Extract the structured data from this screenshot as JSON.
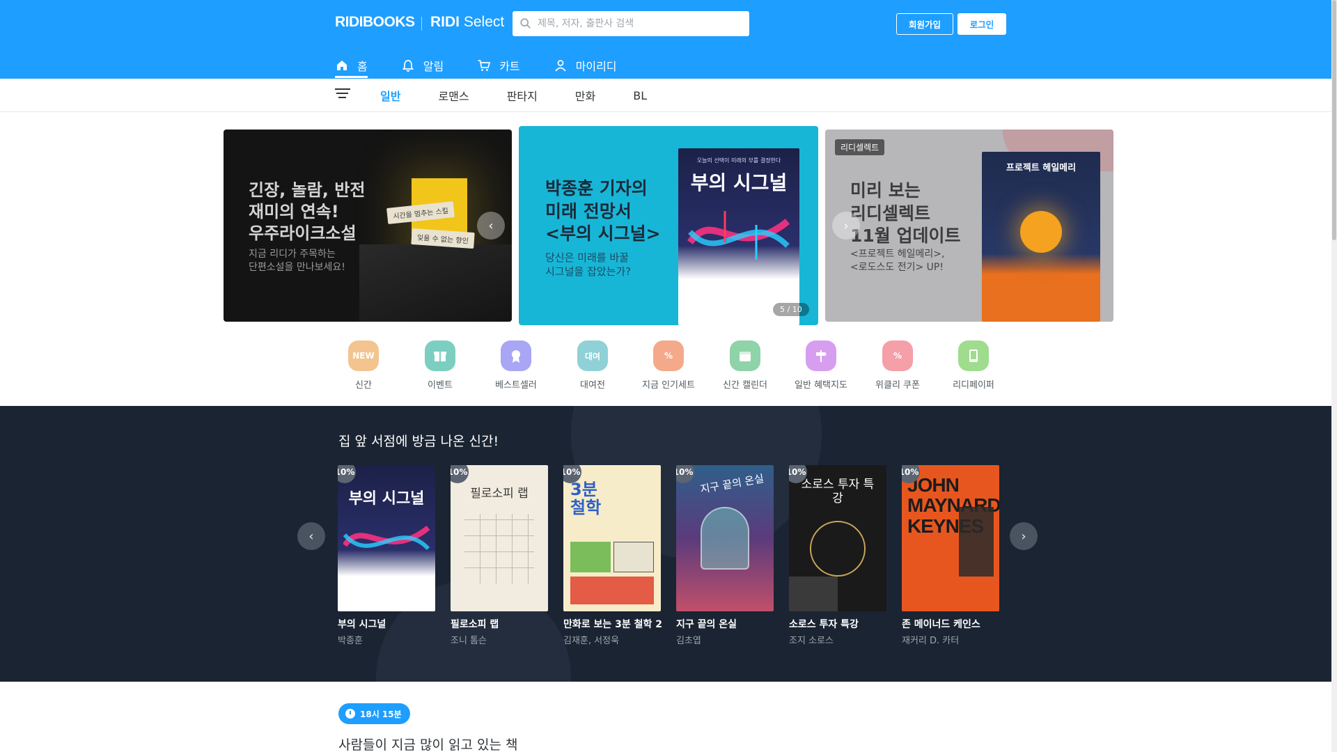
{
  "header": {
    "logo_main": "RIDIBOOKS",
    "logo_select_a": "RIDI",
    "logo_select_b": "Select",
    "search_placeholder": "제목, 저자, 출판사 검색",
    "signup_label": "회원가입",
    "login_label": "로그인",
    "tabs": [
      {
        "label": "홈",
        "icon": "home-icon",
        "active": true
      },
      {
        "label": "알림",
        "icon": "bell-icon"
      },
      {
        "label": "카트",
        "icon": "cart-icon"
      },
      {
        "label": "마이리디",
        "icon": "user-icon"
      }
    ],
    "colors": {
      "brand": "#1e9eff"
    }
  },
  "category_nav": {
    "tabs": [
      {
        "label": "일반",
        "active": true
      },
      {
        "label": "로맨스"
      },
      {
        "label": "판타지"
      },
      {
        "label": "만화"
      },
      {
        "label": "BL"
      }
    ]
  },
  "carousel": {
    "counter": "5 / 10",
    "banners": [
      {
        "title_lines": [
          "긴장, 놀람, 반전",
          "재미의 연속!",
          "우주라이크소설"
        ],
        "sub_lines": [
          "지금 리디가 주목하는",
          "단편소설을 만나보세요!"
        ],
        "notes": [
          "시간을 멈추는 스킬",
          "잊을 수 없는 향인"
        ]
      },
      {
        "title_lines": [
          "박종훈 기자의",
          "미래 전망서",
          "<부의 시그널>"
        ],
        "sub_lines": [
          "당신은 미래를 바꿀",
          "시그널을 잡았는가?"
        ],
        "cover_kicker": "오늘의 선택이 미래의 부를 결정한다",
        "cover_title": "부의 시그널"
      },
      {
        "badge": "리디셀렉트",
        "title_lines": [
          "미리 보는",
          "리디셀렉트",
          "11월 업데이트"
        ],
        "sub_lines": [
          "<프로젝트 헤일메리>,",
          "<로도스도 전기> UP!"
        ],
        "cover_title": "프로젝트 헤일메리"
      }
    ]
  },
  "quick_menu": [
    {
      "label": "신간",
      "icon": "new-icon",
      "glyph": "NEW",
      "color": "#f3c48f"
    },
    {
      "label": "이벤트",
      "icon": "gift-icon",
      "glyph": "",
      "color": "#7ccfc0"
    },
    {
      "label": "베스트셀러",
      "icon": "medal-icon",
      "glyph": "",
      "color": "#a9a6f5"
    },
    {
      "label": "대여전",
      "icon": "rent-icon",
      "glyph": "대여",
      "color": "#8fd1d6"
    },
    {
      "label": "지금 인기세트",
      "icon": "set-icon",
      "glyph": "%",
      "color": "#f4a98a"
    },
    {
      "label": "신간 캘린더",
      "icon": "calendar-icon",
      "glyph": "",
      "color": "#8fd3a8"
    },
    {
      "label": "일반 혜택지도",
      "icon": "signpost-icon",
      "glyph": "",
      "color": "#d79ef0"
    },
    {
      "label": "위클리 쿠폰",
      "icon": "coupon-icon",
      "glyph": "%",
      "color": "#f59fa8"
    },
    {
      "label": "리디페이퍼",
      "icon": "ereader-icon",
      "glyph": "",
      "color": "#9fdc8e"
    }
  ],
  "new_releases": {
    "title": "집 앞 서점에 방금 나온 신간!",
    "books": [
      {
        "title": "부의 시그널",
        "author": "박종훈",
        "discount": "10%",
        "cover_text": "부의 시그널",
        "cover_bg": "#1c2148",
        "cover_fg": "#ffffff"
      },
      {
        "title": "필로소피 랩",
        "author": "조니 톰슨",
        "discount": "10%",
        "cover_text": "필로소피 랩",
        "cover_bg": "#f1ecdf",
        "cover_fg": "#3a3a3a"
      },
      {
        "title": "만화로 보는 3분 철학 2",
        "author": "김재훈, 서정욱",
        "discount": "10%",
        "cover_text": "3분 철학",
        "cover_bg": "#f7ecc9",
        "cover_fg": "#2c60c9"
      },
      {
        "title": "지구 끝의 온실",
        "author": "김초엽",
        "discount": "10%",
        "cover_text": "지구 끝의 온실",
        "cover_bg": "#2f5f8a",
        "cover_fg": "#ffffff"
      },
      {
        "title": "소로스 투자 특강",
        "author": "조지 소로스",
        "discount": "10%",
        "cover_text": "소로스 투자 특강",
        "cover_bg": "#1a1a1a",
        "cover_fg": "#e7d49a"
      },
      {
        "title": "존 메이너드 케인스",
        "author": "재커리 D. 카터",
        "discount": "10%",
        "cover_text": "JOHN MAYNARD KEYNES",
        "cover_bg": "#e8561f",
        "cover_fg": "#1c1c1c"
      }
    ]
  },
  "popular_now": {
    "time": "18시 15분",
    "title": "사람들이 지금 많이 읽고 있는 책"
  }
}
